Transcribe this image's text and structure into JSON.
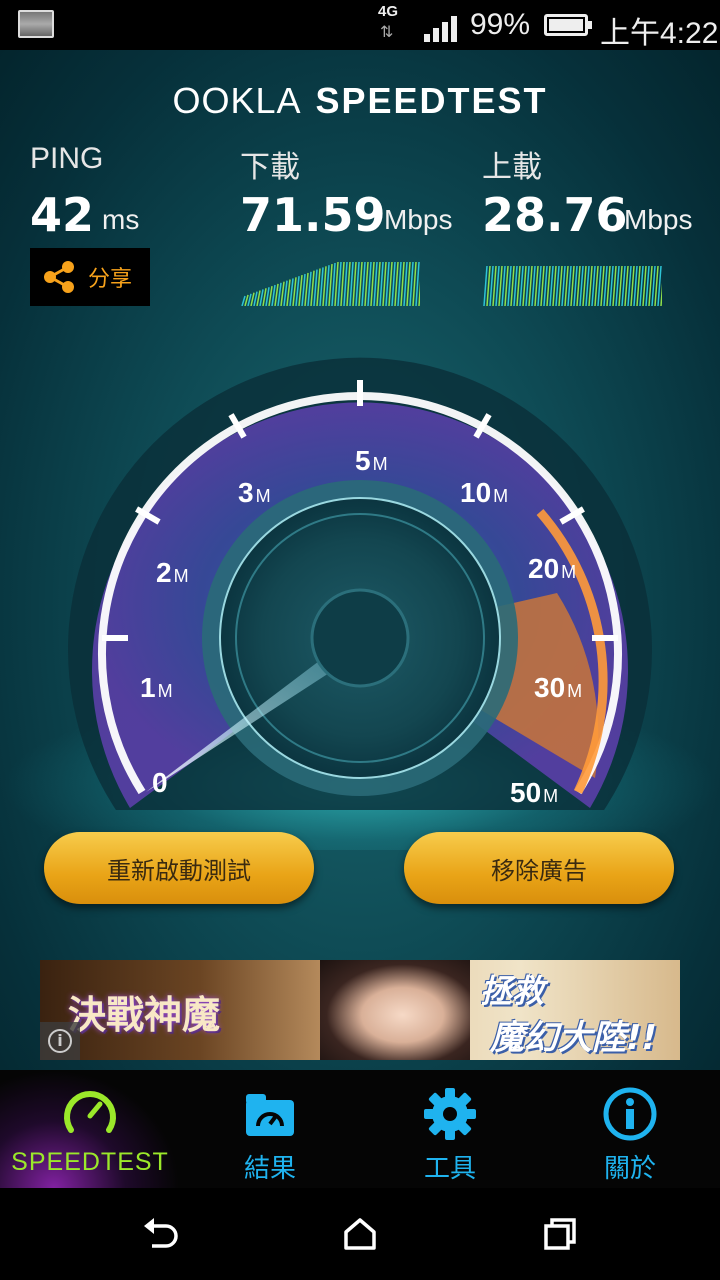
{
  "status_bar": {
    "network": "4G",
    "battery_percent": "99%",
    "time": "上午4:22",
    "signal_bars": 4
  },
  "header": {
    "logo_ookla": "OOKLA",
    "logo_speedtest": "SPEEDTEST"
  },
  "results": {
    "ping": {
      "label": "PING",
      "value": "42",
      "unit": "ms"
    },
    "download": {
      "label": "下載",
      "value": "71.59",
      "unit": "Mbps"
    },
    "upload": {
      "label": "上載",
      "value": "28.76",
      "unit": "Mbps"
    },
    "share_label": "分享"
  },
  "gauge": {
    "ticks": [
      {
        "num": "0",
        "unit": ""
      },
      {
        "num": "1",
        "unit": "M"
      },
      {
        "num": "2",
        "unit": "M"
      },
      {
        "num": "3",
        "unit": "M"
      },
      {
        "num": "5",
        "unit": "M"
      },
      {
        "num": "10",
        "unit": "M"
      },
      {
        "num": "20",
        "unit": "M"
      },
      {
        "num": "30",
        "unit": "M"
      },
      {
        "num": "50",
        "unit": "M"
      }
    ]
  },
  "buttons": {
    "restart": "重新啟動測試",
    "remove_ads": "移除廣告"
  },
  "ad": {
    "left_text": "決戰神魔",
    "right_line1": "拯救",
    "right_line2": "魔幻大陸!!",
    "info_symbol": "i"
  },
  "tabs": {
    "speedtest": "SPEEDTEST",
    "results": "結果",
    "tools": "工具",
    "about": "關於"
  },
  "colors": {
    "accent_green": "#9be82a",
    "accent_blue": "#1fb3ef",
    "button_gold": "#e9a417",
    "share_orange": "#f7a21b"
  }
}
